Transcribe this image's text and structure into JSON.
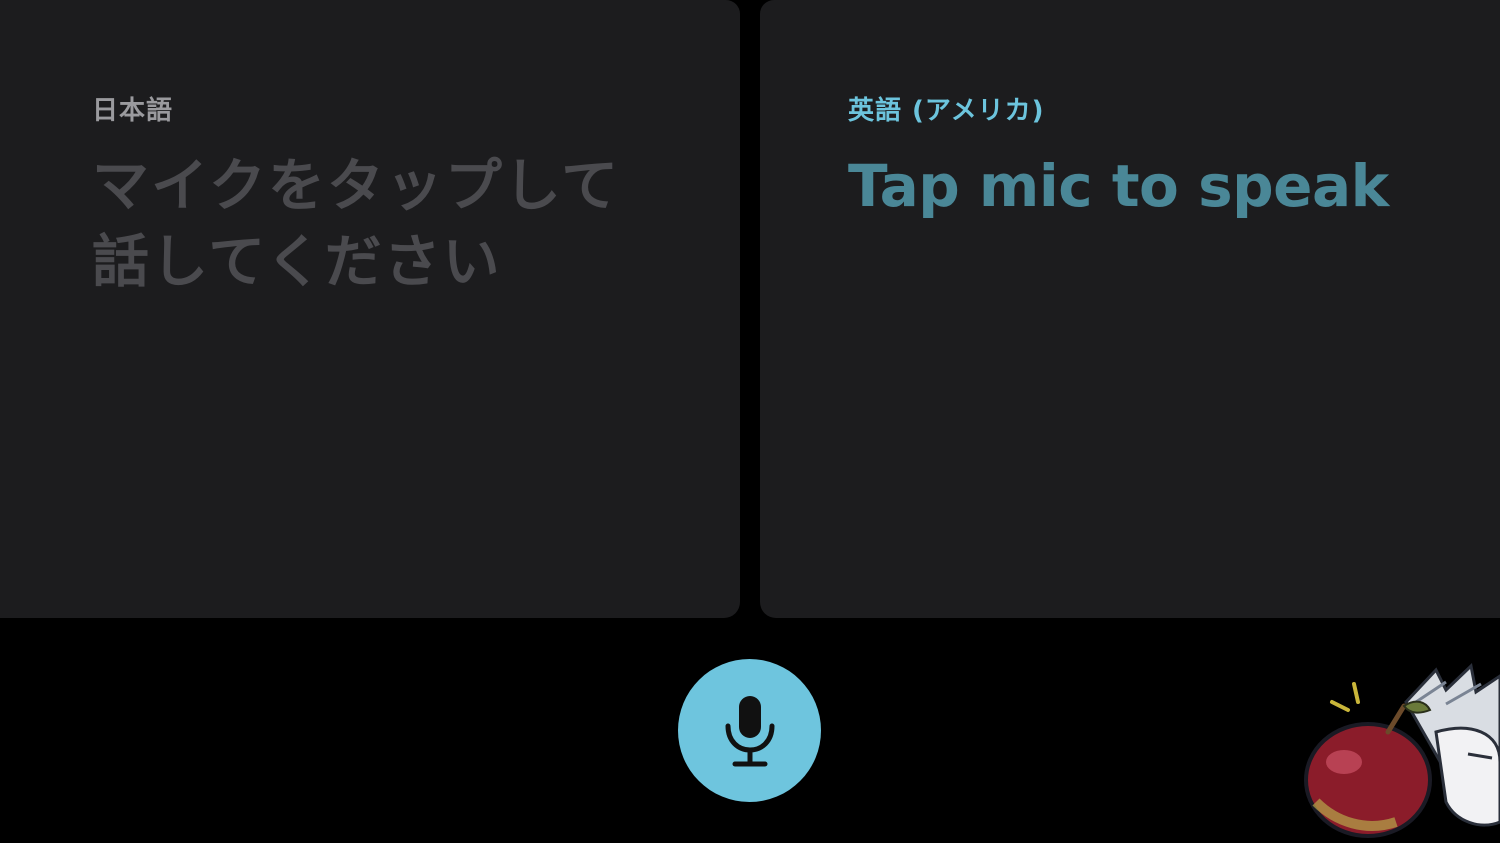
{
  "source_panel": {
    "language_label": "日本語",
    "prompt": "マイクをタップして話してください"
  },
  "target_panel": {
    "language_label": "英語 (アメリカ)",
    "prompt": "Tap mic to speak"
  },
  "mic_button": {
    "icon": "microphone-icon"
  },
  "watermark": {
    "icon": "apple-mascot-icon"
  },
  "colors": {
    "background": "#000000",
    "panel": "#1c1c1e",
    "accent": "#6ec5de",
    "target_text": "#4a8797",
    "source_text": "#4a4a4e",
    "source_label": "#9a9a9e"
  }
}
